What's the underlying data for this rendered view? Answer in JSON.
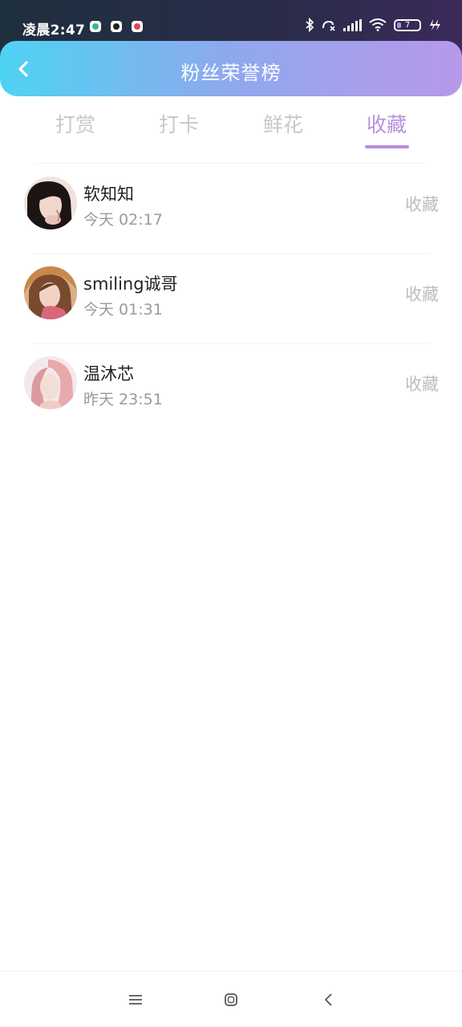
{
  "status_bar": {
    "time": "凌晨2:47",
    "battery_level": "7",
    "notification_icons": [
      "app-icon-green",
      "app-icon-dark",
      "app-icon-red"
    ],
    "system_icons": [
      "bluetooth-icon",
      "missed-call-icon",
      "signal-icon",
      "wifi-icon",
      "battery-icon",
      "charging-icon"
    ]
  },
  "header": {
    "title": "粉丝荣誉榜",
    "back_icon": "chevron-left-icon"
  },
  "tabs": [
    {
      "label": "打赏",
      "active": false
    },
    {
      "label": "打卡",
      "active": false
    },
    {
      "label": "鲜花",
      "active": false
    },
    {
      "label": "收藏",
      "active": true
    }
  ],
  "fans": [
    {
      "name": "软知知",
      "time": "今天 02:17",
      "action": "收藏"
    },
    {
      "name": "smiling诚哥",
      "time": "今天 01:31",
      "action": "收藏"
    },
    {
      "name": "温沐芯",
      "time": "昨天 23:51",
      "action": "收藏"
    }
  ],
  "nav_bar": {
    "icons": [
      "menu-icon",
      "home-icon",
      "back-icon"
    ]
  },
  "colors": {
    "header_gradient_start": "#4dd3f4",
    "header_gradient_end": "#b898ea",
    "tab_active": "#b591db",
    "tab_inactive": "#c8c8c8",
    "action_text": "#bdbdbd"
  }
}
